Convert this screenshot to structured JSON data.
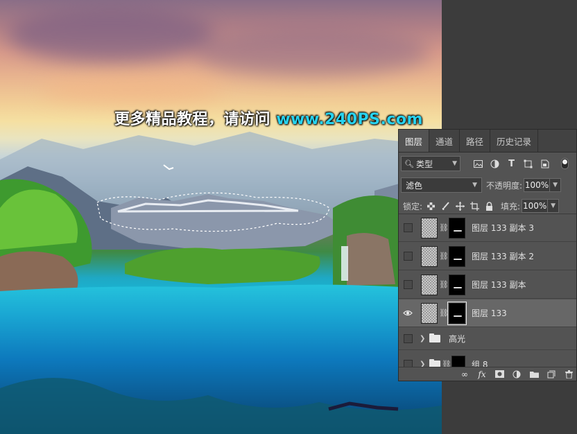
{
  "watermark": {
    "text": "更多精品教程，请访问",
    "url": "www.240PS.com"
  },
  "layers_panel": {
    "tabs": [
      {
        "label": "图层"
      },
      {
        "label": "通道"
      },
      {
        "label": "路径"
      },
      {
        "label": "历史记录"
      }
    ],
    "filter": {
      "label": "类型"
    },
    "blend_mode": "滤色",
    "opacity_label": "不透明度:",
    "opacity_value": "100%",
    "lock_label": "锁定:",
    "fill_label": "填充:",
    "fill_value": "100%",
    "layers": [
      {
        "name": "图层 133 副本 3",
        "visible": false,
        "selected": false
      },
      {
        "name": "图层 133 副本 2",
        "visible": false,
        "selected": false
      },
      {
        "name": "图层 133 副本",
        "visible": false,
        "selected": false
      },
      {
        "name": "图层 133",
        "visible": true,
        "selected": true
      },
      {
        "name": "高光",
        "visible": false,
        "type": "group"
      },
      {
        "name": "组 8",
        "visible": false,
        "type": "group-mask"
      }
    ],
    "bottom_icons": [
      "link-icon",
      "fx-icon",
      "mask-icon",
      "adjustment-icon",
      "folder-icon",
      "new-layer-icon",
      "trash-icon"
    ]
  }
}
